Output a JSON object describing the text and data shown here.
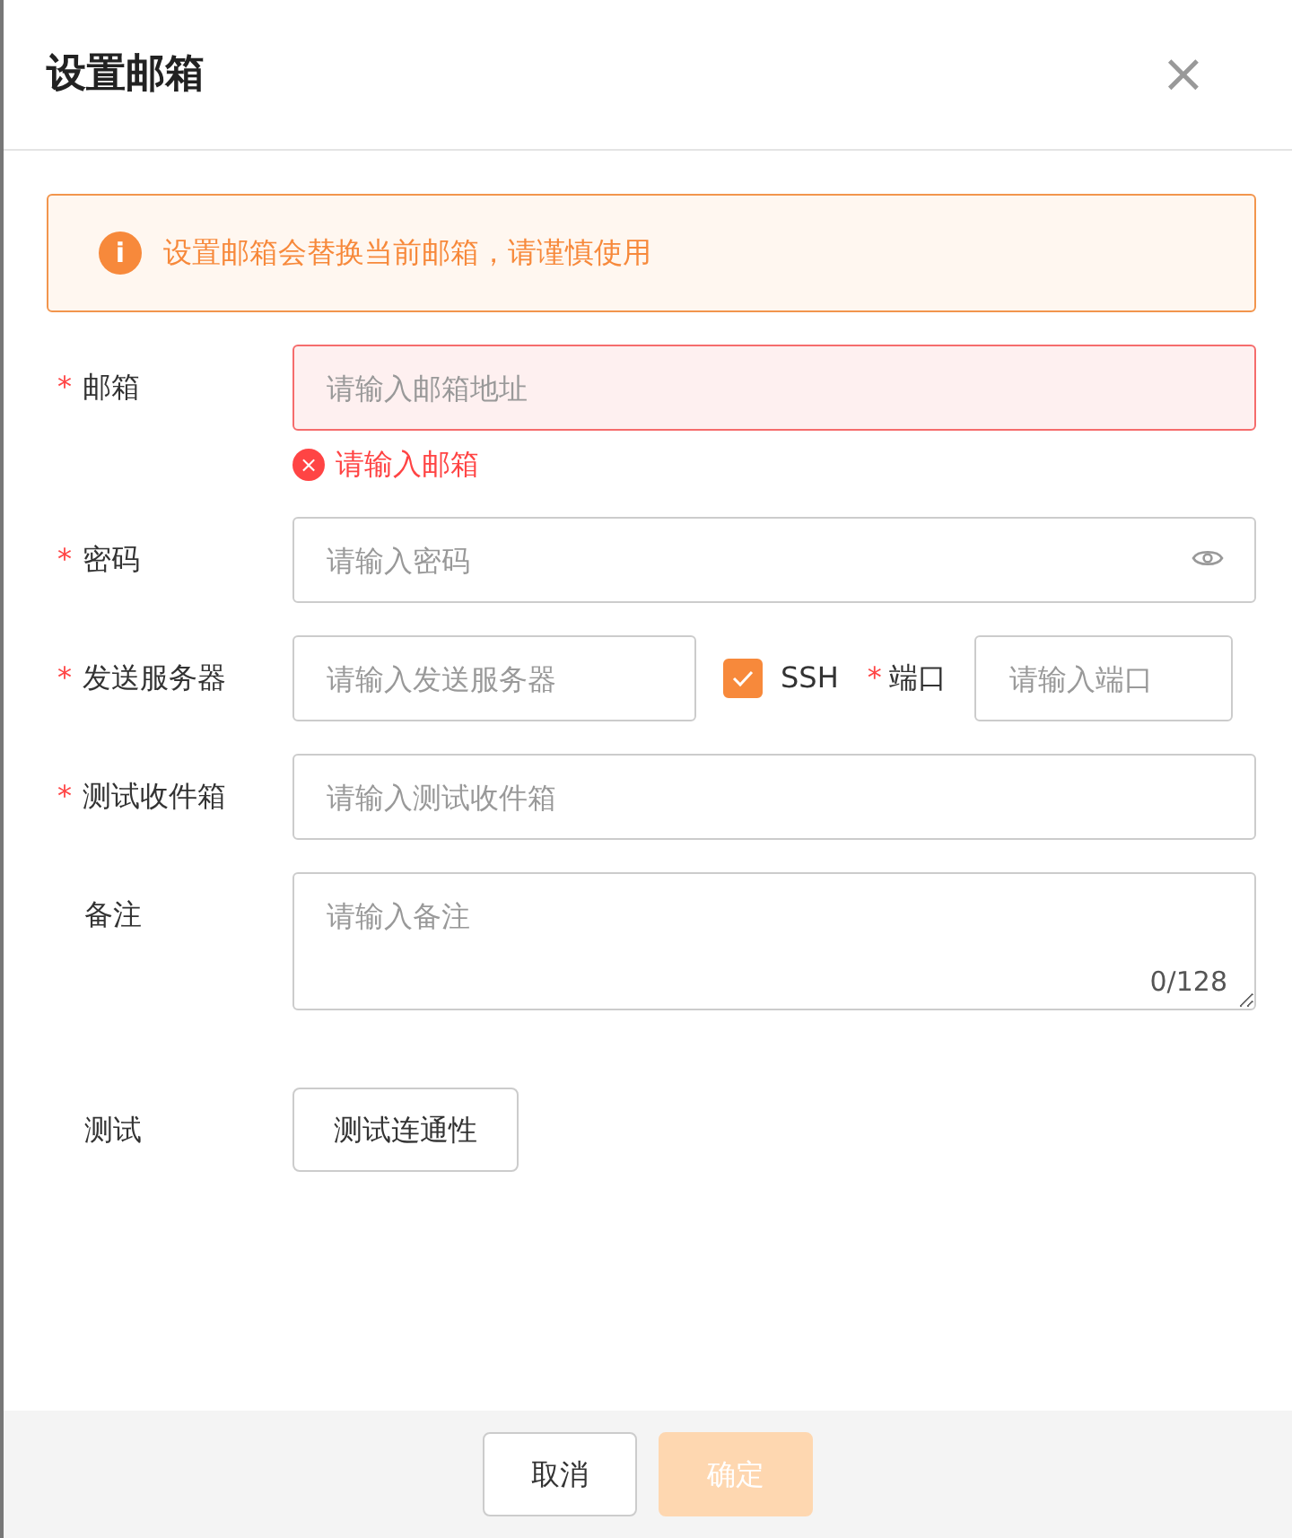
{
  "dialog": {
    "title": "设置邮箱",
    "close": "×"
  },
  "alert": {
    "icon": "i",
    "text": "设置邮箱会替换当前邮箱，请谨慎使用"
  },
  "fields": [
    {
      "kind": "text",
      "label": "邮箱",
      "required_mark": "*",
      "placeholder": "请输入邮箱地址",
      "error": "请输入邮箱",
      "error_icon": "×"
    },
    {
      "kind": "password",
      "label": "密码",
      "required_mark": "*",
      "placeholder": "请输入密码"
    },
    {
      "kind": "server",
      "label": "发送服务器",
      "required_mark": "*",
      "placeholder": "请输入发送服务器",
      "option": {
        "label": "SSH",
        "checked": true
      },
      "port": {
        "label": "端口",
        "required_mark": "*",
        "placeholder": "请输入端口"
      }
    },
    {
      "kind": "text",
      "label": "测试收件箱",
      "required_mark": "*",
      "placeholder": "请输入测试收件箱"
    },
    {
      "kind": "textarea",
      "label": "备注",
      "placeholder": "请输入备注",
      "counter": "0/128"
    },
    {
      "kind": "button",
      "label": "测试",
      "button": "测试连通性"
    }
  ],
  "footer": {
    "buttons": [
      {
        "label": "取消",
        "kind": "default",
        "disabled": false
      },
      {
        "label": "确定",
        "kind": "primary",
        "disabled": true
      }
    ]
  }
}
